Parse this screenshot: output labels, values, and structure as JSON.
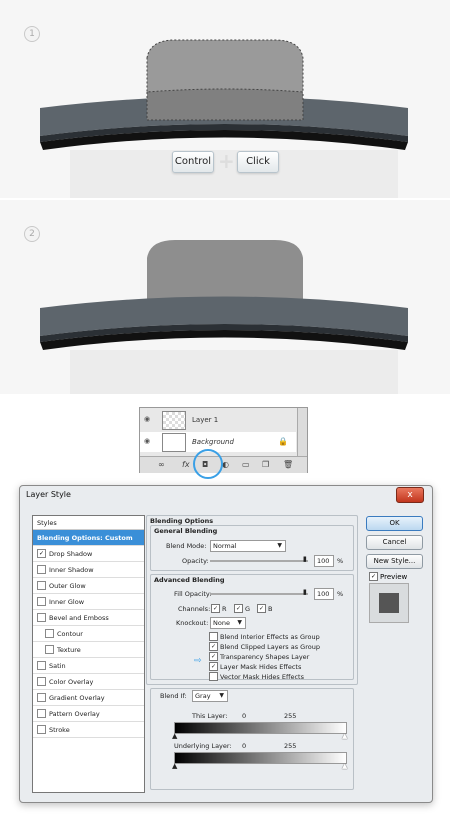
{
  "step1": {
    "number": "1",
    "keys": {
      "control": "Control",
      "plus": "+",
      "click": "Click"
    }
  },
  "step2": {
    "number": "2"
  },
  "layers_panel": {
    "layers": [
      {
        "name": "Layer 1"
      },
      {
        "name": "Background",
        "lock_icon": "lock-icon"
      }
    ],
    "bottom_icons": [
      "link-icon",
      "fx-icon",
      "add-mask-icon",
      "adjustment-icon",
      "folder-icon",
      "new-layer-icon",
      "trash-icon"
    ]
  },
  "dialog": {
    "title": "Layer Style",
    "close": "x",
    "styles_header": "Styles",
    "styles": [
      {
        "label": "Blending Options: Custom",
        "selected": true,
        "checkbox": false
      },
      {
        "label": "Drop Shadow",
        "checked": true,
        "checkbox": true
      },
      {
        "label": "Inner Shadow",
        "checked": false,
        "checkbox": true
      },
      {
        "label": "Outer Glow",
        "checked": false,
        "checkbox": true
      },
      {
        "label": "Inner Glow",
        "checked": false,
        "checkbox": true
      },
      {
        "label": "Bevel and Emboss",
        "checked": false,
        "checkbox": true
      },
      {
        "label": "Contour",
        "checked": false,
        "checkbox": true,
        "indent": true
      },
      {
        "label": "Texture",
        "checked": false,
        "checkbox": true,
        "indent": true
      },
      {
        "label": "Satin",
        "checked": false,
        "checkbox": true
      },
      {
        "label": "Color Overlay",
        "checked": false,
        "checkbox": true
      },
      {
        "label": "Gradient Overlay",
        "checked": false,
        "checkbox": true
      },
      {
        "label": "Pattern Overlay",
        "checked": false,
        "checkbox": true
      },
      {
        "label": "Stroke",
        "checked": false,
        "checkbox": true
      }
    ],
    "blending_options": {
      "title": "Blending Options",
      "general": {
        "title": "General Blending",
        "blend_mode_label": "Blend Mode:",
        "blend_mode_value": "Normal",
        "opacity_label": "Opacity:",
        "opacity_value": "100",
        "opacity_unit": "%"
      },
      "advanced": {
        "title": "Advanced Blending",
        "fill_opacity_label": "Fill Opacity:",
        "fill_opacity_value": "100",
        "fill_opacity_unit": "%",
        "channels_label": "Channels:",
        "channels": [
          "R",
          "G",
          "B"
        ],
        "knockout_label": "Knockout:",
        "knockout_value": "None",
        "options": [
          {
            "label": "Blend Interior Effects as Group",
            "checked": false
          },
          {
            "label": "Blend Clipped Layers as Group",
            "checked": true
          },
          {
            "label": "Transparency Shapes Layer",
            "checked": true
          },
          {
            "label": "Layer Mask Hides Effects",
            "checked": true
          },
          {
            "label": "Vector Mask Hides Effects",
            "checked": false
          }
        ]
      },
      "blend_if": {
        "label": "Blend If:",
        "value": "Gray",
        "this_layer_label": "This Layer:",
        "this_layer_min": "0",
        "this_layer_max": "255",
        "underlying_label": "Underlying Layer:",
        "underlying_min": "0",
        "underlying_max": "255"
      }
    },
    "buttons": {
      "ok": "OK",
      "cancel": "Cancel",
      "new_style": "New Style...",
      "preview": "Preview"
    },
    "colors": {
      "accent": "#3a8fd8",
      "swatch": "#555555"
    }
  }
}
